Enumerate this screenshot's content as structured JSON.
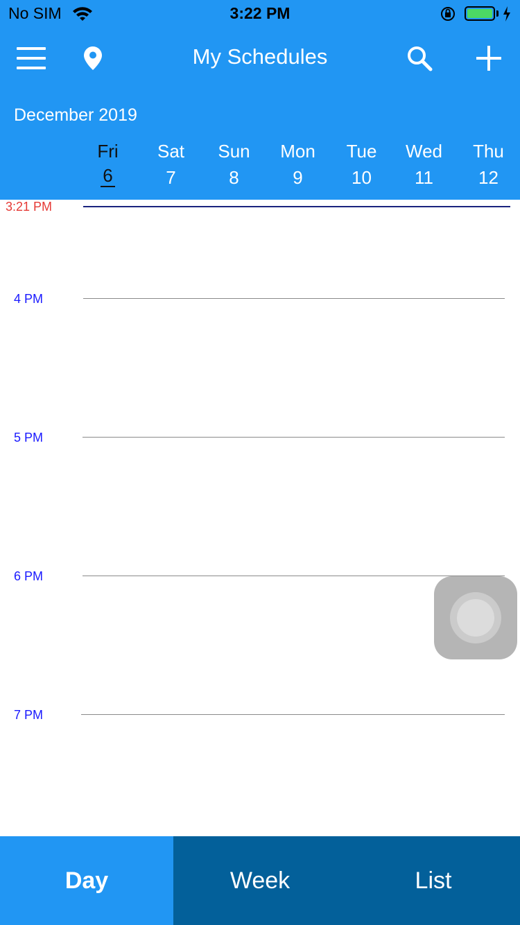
{
  "status_bar": {
    "carrier": "No SIM",
    "time": "3:22 PM",
    "battery_level": 1.0,
    "battery_color": "#4cd964"
  },
  "nav": {
    "title": "My Schedules",
    "icons": [
      "hamburger-menu-icon",
      "location-pin-icon",
      "search-icon",
      "plus-icon"
    ]
  },
  "calendar": {
    "month": "December 2019",
    "days": [
      {
        "name": "Fri",
        "num": "6",
        "selected": true
      },
      {
        "name": "Sat",
        "num": "7",
        "selected": false
      },
      {
        "name": "Sun",
        "num": "8",
        "selected": false
      },
      {
        "name": "Mon",
        "num": "9",
        "selected": false
      },
      {
        "name": "Tue",
        "num": "10",
        "selected": false
      },
      {
        "name": "Wed",
        "num": "11",
        "selected": false
      },
      {
        "name": "Thu",
        "num": "12",
        "selected": false
      }
    ]
  },
  "timeline": {
    "current_time": "3:21 PM",
    "hours": [
      "4 PM",
      "5 PM",
      "6 PM",
      "7 PM"
    ]
  },
  "tabs": [
    {
      "label": "Day",
      "active": true
    },
    {
      "label": "Week",
      "active": false
    },
    {
      "label": "List",
      "active": false
    }
  ],
  "colors": {
    "header": "#2196F3",
    "tab_bar": "#03609a",
    "current_time": "#e53935",
    "hour_label": "#1a1aff"
  }
}
